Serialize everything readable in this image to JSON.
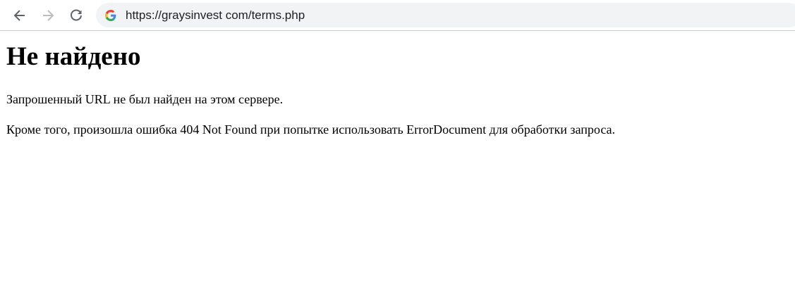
{
  "browser": {
    "url": "https://graysinvest com/terms.php",
    "icons": {
      "back": "arrow-left-icon",
      "forward": "arrow-right-icon",
      "reload": "reload-icon",
      "site": "google-g-icon"
    },
    "colors": {
      "omnibox_bg": "#f1f3f4",
      "icon_active": "#5f6368",
      "icon_disabled": "#babcbe"
    }
  },
  "page": {
    "heading": "Не найдено",
    "paragraph1": "Запрошенный URL не был найден на этом сервере.",
    "paragraph2": "Кроме того, произошла ошибка 404 Not Found при попытке использовать ErrorDocument для обработки запроса."
  }
}
